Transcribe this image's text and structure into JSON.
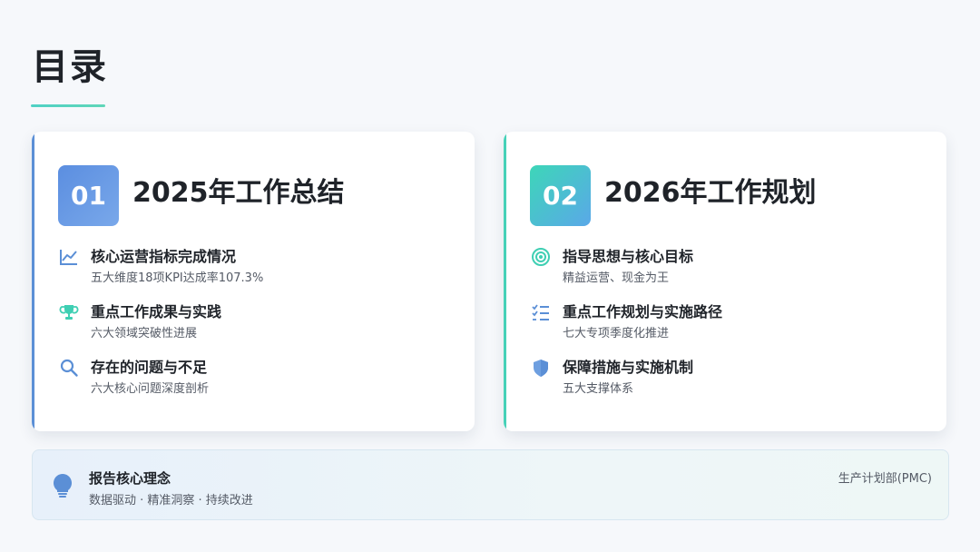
{
  "page": {
    "title": "目录"
  },
  "sections": [
    {
      "number": "01",
      "title": "2025年工作总结",
      "accent": "#5b8fd6",
      "items": [
        {
          "icon": "line-chart-icon",
          "title": "核心运营指标完成情况",
          "subtitle": "五大维度18项KPI达成率107.3%"
        },
        {
          "icon": "trophy-icon",
          "title": "重点工作成果与实践",
          "subtitle": "六大领域突破性进展"
        },
        {
          "icon": "search-icon",
          "title": "存在的问题与不足",
          "subtitle": "六大核心问题深度剖析"
        }
      ]
    },
    {
      "number": "02",
      "title": "2026年工作规划",
      "accent": "#46d1b8",
      "items": [
        {
          "icon": "target-icon",
          "title": "指导思想与核心目标",
          "subtitle": "精益运营、现金为王"
        },
        {
          "icon": "checklist-icon",
          "title": "重点工作规划与实施路径",
          "subtitle": "七大专项季度化推进"
        },
        {
          "icon": "shield-icon",
          "title": "保障措施与实施机制",
          "subtitle": "五大支撑体系"
        }
      ]
    }
  ],
  "footer": {
    "icon": "lightbulb-icon",
    "title": "报告核心理念",
    "subtitle": "数据驱动 · 精准洞察 · 持续改进",
    "department": "生产计划部(PMC)"
  }
}
